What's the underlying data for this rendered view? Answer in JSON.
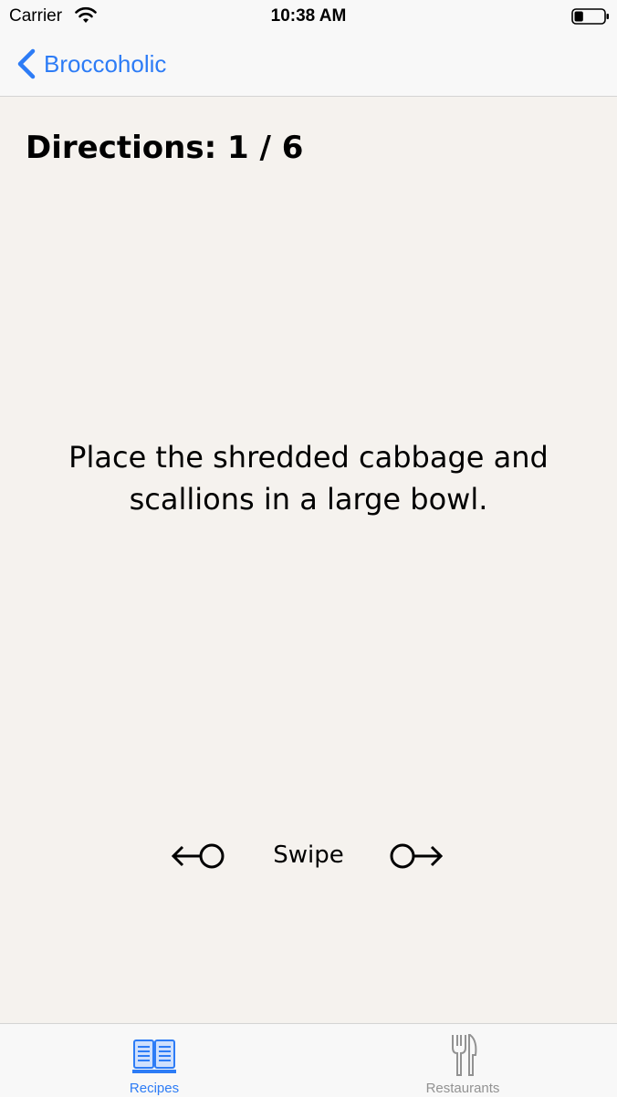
{
  "status_bar": {
    "carrier": "Carrier",
    "time": "10:38 AM",
    "battery_level": 0.3
  },
  "nav": {
    "back_label": "Broccoholic"
  },
  "directions": {
    "title": "Directions: 1 / 6",
    "step_text": "Place the shredded cabbage and scallions in a large bowl.",
    "swipe_label": "Swipe"
  },
  "tabs": [
    {
      "label": "Recipes",
      "icon": "book-icon",
      "selected": true
    },
    {
      "label": "Restaurants",
      "icon": "fork-knife-icon",
      "selected": false
    }
  ],
  "colors": {
    "accent": "#2d7cf6",
    "background": "#f5f2ee",
    "inactive_tab": "#929292"
  }
}
